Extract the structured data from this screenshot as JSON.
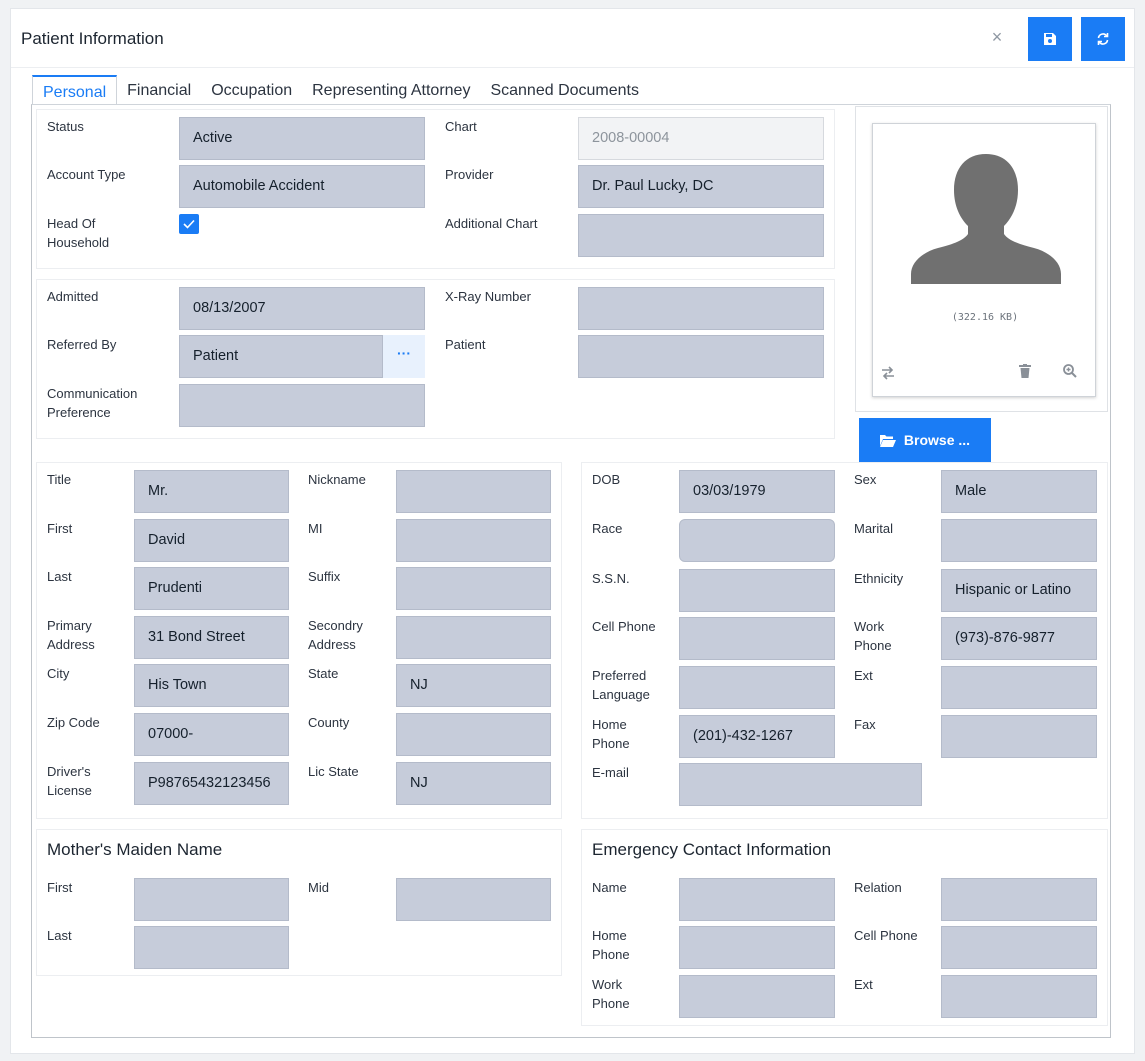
{
  "header": {
    "title": "Patient Information"
  },
  "tabs": [
    "Personal",
    "Financial",
    "Occupation",
    "Representing Attorney",
    "Scanned Documents"
  ],
  "account": {
    "status_label": "Status",
    "status": "Active",
    "account_type_label": "Account Type",
    "account_type": "Automobile Accident",
    "head_label_1": "Head Of",
    "head_label_2": "Household",
    "chart_label": "Chart",
    "chart": "2008-00004",
    "provider_label": "Provider",
    "provider": "Dr. Paul Lucky, DC",
    "additional_chart_label": "Additional Chart",
    "additional_chart": ""
  },
  "admission": {
    "admitted_label": "Admitted",
    "admitted": "08/13/2007",
    "referred_label": "Referred By",
    "referred": "Patient",
    "comm_label_1": "Communication",
    "comm_label_2": "Preference",
    "comm": "",
    "xray_label": "X-Ray Number",
    "xray": "",
    "patient_label": "Patient",
    "patient": ""
  },
  "photo": {
    "size": "(322.16 KB)",
    "browse_label": "Browse ..."
  },
  "name": {
    "title_label": "Title",
    "title": "Mr.",
    "nickname_label": "Nickname",
    "nickname": "",
    "first_label": "First",
    "first": "David",
    "mi_label": "MI",
    "mi": "",
    "last_label": "Last",
    "last": "Prudenti",
    "suffix_label": "Suffix",
    "suffix": "",
    "primary_label_1": "Primary",
    "primary_label_2": "Address",
    "primary": "31 Bond Street",
    "secondary_label_1": "Secondry",
    "secondary_label_2": "Address",
    "secondary": "",
    "city_label": "City",
    "city": "His Town",
    "state_label": "State",
    "state": "NJ",
    "zip_label": "Zip Code",
    "zip": "07000-",
    "county_label": "County",
    "county": "",
    "dl_label_1": "Driver's",
    "dl_label_2": "License",
    "dl": "P98765432123456",
    "lic_state_label": "Lic State",
    "lic_state": "NJ"
  },
  "demo": {
    "dob_label": "DOB",
    "dob": "03/03/1979",
    "sex_label": "Sex",
    "sex": "Male",
    "race_label": "Race",
    "race": "",
    "marital_label": "Marital",
    "marital": "",
    "ssn_label": "S.S.N.",
    "ssn": "",
    "ethnicity_label": "Ethnicity",
    "ethnicity": "Hispanic or Latino",
    "cell_label": "Cell Phone",
    "cell": "",
    "work_label_1": "Work",
    "work_label_2": "Phone",
    "work": "(973)-876-9877",
    "lang_label_1": "Preferred",
    "lang_label_2": "Language",
    "lang": "",
    "ext_label": "Ext",
    "ext": "",
    "home_label_1": "Home",
    "home_label_2": "Phone",
    "home": "(201)-432-1267",
    "fax_label": "Fax",
    "fax": "",
    "email_label": "E-mail",
    "email": ""
  },
  "mother": {
    "section_title": "Mother's Maiden Name",
    "first_label": "First",
    "first": "",
    "mid_label": "Mid",
    "mid": "",
    "last_label": "Last",
    "last": ""
  },
  "emergency": {
    "section_title": "Emergency Contact Information",
    "name_label": "Name",
    "name": "",
    "relation_label": "Relation",
    "relation": "",
    "home_label_1": "Home",
    "home_label_2": "Phone",
    "home": "",
    "cell_label": "Cell Phone",
    "cell": "",
    "work_label_1": "Work",
    "work_label_2": "Phone",
    "work": "",
    "ext_label": "Ext",
    "ext": ""
  }
}
